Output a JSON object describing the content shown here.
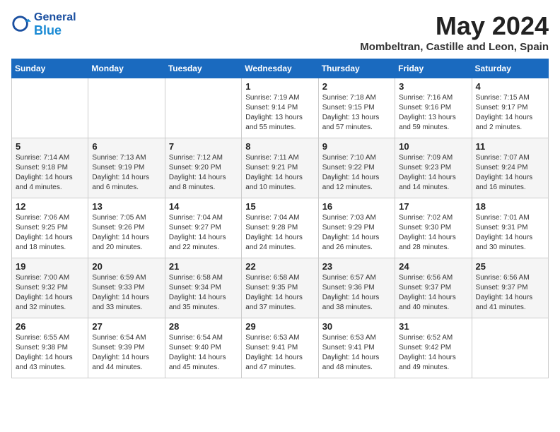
{
  "logo": {
    "general": "General",
    "blue": "Blue"
  },
  "title": "May 2024",
  "location": "Mombeltran, Castille and Leon, Spain",
  "days_header": [
    "Sunday",
    "Monday",
    "Tuesday",
    "Wednesday",
    "Thursday",
    "Friday",
    "Saturday"
  ],
  "weeks": [
    [
      {
        "day": "",
        "content": ""
      },
      {
        "day": "",
        "content": ""
      },
      {
        "day": "",
        "content": ""
      },
      {
        "day": "1",
        "content": "Sunrise: 7:19 AM\nSunset: 9:14 PM\nDaylight: 13 hours\nand 55 minutes."
      },
      {
        "day": "2",
        "content": "Sunrise: 7:18 AM\nSunset: 9:15 PM\nDaylight: 13 hours\nand 57 minutes."
      },
      {
        "day": "3",
        "content": "Sunrise: 7:16 AM\nSunset: 9:16 PM\nDaylight: 13 hours\nand 59 minutes."
      },
      {
        "day": "4",
        "content": "Sunrise: 7:15 AM\nSunset: 9:17 PM\nDaylight: 14 hours\nand 2 minutes."
      }
    ],
    [
      {
        "day": "5",
        "content": "Sunrise: 7:14 AM\nSunset: 9:18 PM\nDaylight: 14 hours\nand 4 minutes."
      },
      {
        "day": "6",
        "content": "Sunrise: 7:13 AM\nSunset: 9:19 PM\nDaylight: 14 hours\nand 6 minutes."
      },
      {
        "day": "7",
        "content": "Sunrise: 7:12 AM\nSunset: 9:20 PM\nDaylight: 14 hours\nand 8 minutes."
      },
      {
        "day": "8",
        "content": "Sunrise: 7:11 AM\nSunset: 9:21 PM\nDaylight: 14 hours\nand 10 minutes."
      },
      {
        "day": "9",
        "content": "Sunrise: 7:10 AM\nSunset: 9:22 PM\nDaylight: 14 hours\nand 12 minutes."
      },
      {
        "day": "10",
        "content": "Sunrise: 7:09 AM\nSunset: 9:23 PM\nDaylight: 14 hours\nand 14 minutes."
      },
      {
        "day": "11",
        "content": "Sunrise: 7:07 AM\nSunset: 9:24 PM\nDaylight: 14 hours\nand 16 minutes."
      }
    ],
    [
      {
        "day": "12",
        "content": "Sunrise: 7:06 AM\nSunset: 9:25 PM\nDaylight: 14 hours\nand 18 minutes."
      },
      {
        "day": "13",
        "content": "Sunrise: 7:05 AM\nSunset: 9:26 PM\nDaylight: 14 hours\nand 20 minutes."
      },
      {
        "day": "14",
        "content": "Sunrise: 7:04 AM\nSunset: 9:27 PM\nDaylight: 14 hours\nand 22 minutes."
      },
      {
        "day": "15",
        "content": "Sunrise: 7:04 AM\nSunset: 9:28 PM\nDaylight: 14 hours\nand 24 minutes."
      },
      {
        "day": "16",
        "content": "Sunrise: 7:03 AM\nSunset: 9:29 PM\nDaylight: 14 hours\nand 26 minutes."
      },
      {
        "day": "17",
        "content": "Sunrise: 7:02 AM\nSunset: 9:30 PM\nDaylight: 14 hours\nand 28 minutes."
      },
      {
        "day": "18",
        "content": "Sunrise: 7:01 AM\nSunset: 9:31 PM\nDaylight: 14 hours\nand 30 minutes."
      }
    ],
    [
      {
        "day": "19",
        "content": "Sunrise: 7:00 AM\nSunset: 9:32 PM\nDaylight: 14 hours\nand 32 minutes."
      },
      {
        "day": "20",
        "content": "Sunrise: 6:59 AM\nSunset: 9:33 PM\nDaylight: 14 hours\nand 33 minutes."
      },
      {
        "day": "21",
        "content": "Sunrise: 6:58 AM\nSunset: 9:34 PM\nDaylight: 14 hours\nand 35 minutes."
      },
      {
        "day": "22",
        "content": "Sunrise: 6:58 AM\nSunset: 9:35 PM\nDaylight: 14 hours\nand 37 minutes."
      },
      {
        "day": "23",
        "content": "Sunrise: 6:57 AM\nSunset: 9:36 PM\nDaylight: 14 hours\nand 38 minutes."
      },
      {
        "day": "24",
        "content": "Sunrise: 6:56 AM\nSunset: 9:37 PM\nDaylight: 14 hours\nand 40 minutes."
      },
      {
        "day": "25",
        "content": "Sunrise: 6:56 AM\nSunset: 9:37 PM\nDaylight: 14 hours\nand 41 minutes."
      }
    ],
    [
      {
        "day": "26",
        "content": "Sunrise: 6:55 AM\nSunset: 9:38 PM\nDaylight: 14 hours\nand 43 minutes."
      },
      {
        "day": "27",
        "content": "Sunrise: 6:54 AM\nSunset: 9:39 PM\nDaylight: 14 hours\nand 44 minutes."
      },
      {
        "day": "28",
        "content": "Sunrise: 6:54 AM\nSunset: 9:40 PM\nDaylight: 14 hours\nand 45 minutes."
      },
      {
        "day": "29",
        "content": "Sunrise: 6:53 AM\nSunset: 9:41 PM\nDaylight: 14 hours\nand 47 minutes."
      },
      {
        "day": "30",
        "content": "Sunrise: 6:53 AM\nSunset: 9:41 PM\nDaylight: 14 hours\nand 48 minutes."
      },
      {
        "day": "31",
        "content": "Sunrise: 6:52 AM\nSunset: 9:42 PM\nDaylight: 14 hours\nand 49 minutes."
      },
      {
        "day": "",
        "content": ""
      }
    ]
  ]
}
